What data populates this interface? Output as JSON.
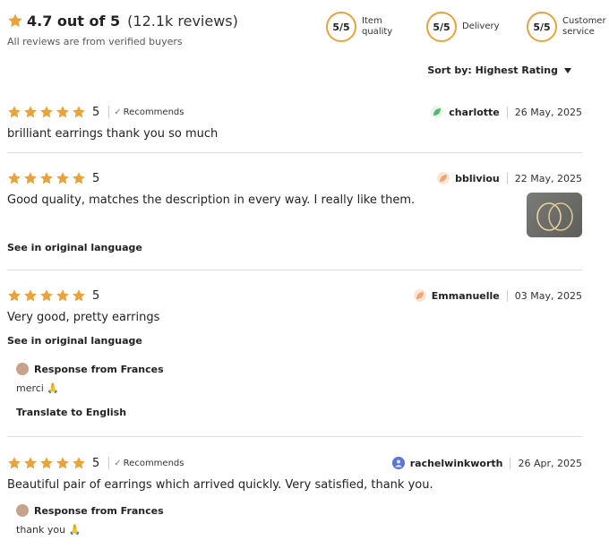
{
  "summary": {
    "rating_text": "4.7 out of 5",
    "review_count": "(12.1k reviews)",
    "verified_note": "All reviews are from verified buyers",
    "star_color": "#e8a33c"
  },
  "scores": [
    {
      "value": "5/5",
      "label": "Item quality"
    },
    {
      "value": "5/5",
      "label": "Delivery"
    },
    {
      "value": "5/5",
      "label": "Customer service"
    }
  ],
  "sort": {
    "label": "Sort by: Highest Rating"
  },
  "reviews": [
    {
      "rating": "5",
      "recommends": "Recommends",
      "username": "charlotte",
      "date": "26 May, 2025",
      "avatar_color": "#54b96b",
      "text": "brilliant earrings thank you so much"
    },
    {
      "rating": "5",
      "username": "bbliviou",
      "date": "22 May, 2025",
      "avatar_color": "#f2a56e",
      "text": "Good quality, matches the description in every way. I really like them.",
      "see_original": "See in original language"
    },
    {
      "rating": "5",
      "username": "Emmanuelle",
      "date": "03 May, 2025",
      "avatar_color": "#f2a56e",
      "text": "Very good, pretty earrings",
      "see_original": "See in original language",
      "response_title": "Response from Frances",
      "response_text": "merci 🙏",
      "translate": "Translate to English"
    },
    {
      "rating": "5",
      "recommends": "Recommends",
      "username": "rachelwinkworth",
      "date": "26 Apr, 2025",
      "avatar_color": "#5b74d6",
      "text": "Beautiful pair of earrings which arrived quickly. Very satisfied, thank you.",
      "response_title": "Response from Frances",
      "response_text": "thank you 🙏"
    }
  ]
}
